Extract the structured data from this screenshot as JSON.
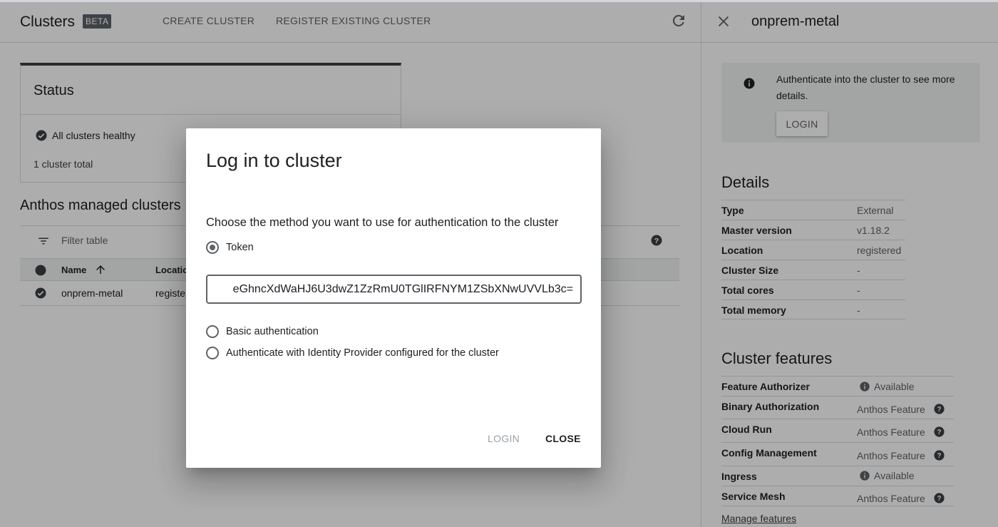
{
  "header": {
    "title": "Clusters",
    "badge": "BETA",
    "create_button": "CREATE CLUSTER",
    "register_button": "REGISTER EXISTING CLUSTER",
    "refresh_icon": "refresh-icon"
  },
  "status": {
    "title": "Status",
    "healthy_text": "All clusters healthy",
    "total_text": "1 cluster total"
  },
  "clusters_section": {
    "title": "Anthos managed clusters",
    "filter_placeholder": "Filter table",
    "columns": [
      "Name",
      "Location"
    ],
    "rows": [
      {
        "name": "onprem-metal",
        "location": "registered"
      }
    ]
  },
  "panel": {
    "title": "onprem-metal",
    "auth_message": "Authenticate into the cluster to see more details.",
    "login_label": "LOGIN",
    "details_title": "Details",
    "details": [
      {
        "key": "Type",
        "value": "External"
      },
      {
        "key": "Master version",
        "value": "v1.18.2"
      },
      {
        "key": "Location",
        "value": "registered"
      },
      {
        "key": "Cluster Size",
        "value": "-"
      },
      {
        "key": "Total cores",
        "value": "-"
      },
      {
        "key": "Total memory",
        "value": "-"
      }
    ],
    "features_title": "Cluster features",
    "features": [
      {
        "key": "Feature Authorizer",
        "value": "Available",
        "icon": "info-icon"
      },
      {
        "key": "Binary Authorization",
        "value": "Anthos Feature",
        "icon": "help-icon"
      },
      {
        "key": "Cloud Run",
        "value": "Anthos Feature",
        "icon": "help-icon"
      },
      {
        "key": "Config Management",
        "value": "Anthos Feature",
        "icon": "help-icon"
      },
      {
        "key": "Ingress",
        "value": "Available",
        "icon": "info-icon"
      },
      {
        "key": "Service Mesh",
        "value": "Anthos Feature",
        "icon": "help-icon"
      }
    ],
    "manage_link": "Manage features"
  },
  "dialog": {
    "title": "Log in to cluster",
    "description": "Choose the method you want to use for authentication to the cluster",
    "options": [
      {
        "label": "Token",
        "selected": true
      },
      {
        "label": "Basic authentication",
        "selected": false
      },
      {
        "label": "Authenticate with Identity Provider configured for the cluster",
        "selected": false
      }
    ],
    "token_value": "eGhncXdWaHJ6U3dwZ1ZzRmU0TGlIRFNYM1ZSbXNwUVVLb3c=",
    "login_label": "LOGIN",
    "close_label": "CLOSE"
  },
  "colors": {
    "accent_dark": "#3c4043",
    "muted_text": "#5f6368",
    "scrim": "rgba(0,0,0,0.32)"
  }
}
